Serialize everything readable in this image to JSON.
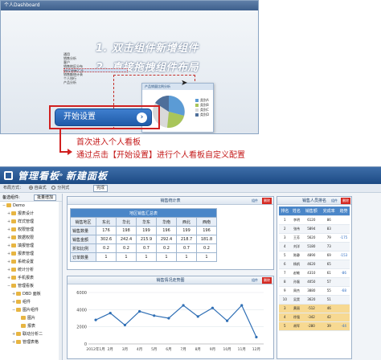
{
  "top_window": {
    "title": "个人Dashboard",
    "overlay_line1": "1. 双击组件新增组件",
    "overlay_line2": "2. 直接拖拽组件布局",
    "mini_tree": [
      "通用",
      "销售分析",
      "客户",
      "销售地区分布",
      "地区销售汇总",
      "销售额统计表",
      "个人排行",
      "产品分析"
    ],
    "mini_pie_title": "产品销量比例分析",
    "mini_pie_legend": [
      "类别A",
      "类别B",
      "类别C",
      "类别D"
    ],
    "mini_pie_colors": [
      "#5b9bd5",
      "#a8c55a",
      "#d9d9d9",
      "#4e6f9a"
    ],
    "start_button": "开始设置"
  },
  "callout": {
    "line1": "首次进入个人看板",
    "line2": "通过点击【开始设置】进行个人看板自定义配置"
  },
  "dashboard": {
    "title": "管理看板",
    "separator": "»",
    "subtitle": "新建面板",
    "toolbar": {
      "layout_label": "布局方式：",
      "option_auto": "自由式",
      "option_split": "分列式",
      "complete_button": "完成"
    },
    "sidebar": {
      "header": "备选组件:",
      "button": "批量增加",
      "items": [
        {
          "label": "Demo",
          "indent": 0,
          "toggle": "−"
        },
        {
          "label": "报表设计",
          "indent": 1,
          "toggle": "+"
        },
        {
          "label": "样式管理",
          "indent": 1,
          "toggle": "+"
        },
        {
          "label": "权限管理",
          "indent": 1,
          "toggle": "+"
        },
        {
          "label": "数据权限",
          "indent": 1,
          "toggle": "+"
        },
        {
          "label": "填报管理",
          "indent": 1,
          "toggle": "+"
        },
        {
          "label": "报表管理",
          "indent": 1,
          "toggle": "+"
        },
        {
          "label": "系统设置",
          "indent": 1,
          "toggle": "+"
        },
        {
          "label": "统计分析",
          "indent": 1,
          "toggle": "+"
        },
        {
          "label": "手机报表",
          "indent": 1,
          "toggle": "+"
        },
        {
          "label": "管理看板",
          "indent": 1,
          "toggle": "−"
        },
        {
          "label": "DBD 面板",
          "indent": 2,
          "toggle": "+"
        },
        {
          "label": "组件",
          "indent": 2,
          "toggle": "+"
        },
        {
          "label": "图片组件",
          "indent": 2,
          "toggle": "−"
        },
        {
          "label": "图片",
          "indent": 3,
          "toggle": ""
        },
        {
          "label": "报表",
          "indent": 3,
          "toggle": ""
        },
        {
          "label": "联动分析二",
          "indent": 2,
          "toggle": "+"
        },
        {
          "label": "管理表格",
          "indent": 2,
          "toggle": "+"
        }
      ]
    },
    "sales_panel": {
      "title": "销售统计表",
      "btn_settings": "组件",
      "btn_delete": "删除",
      "table_caption": "地区销售汇总表",
      "columns": [
        "销售地区",
        "东北",
        "华北",
        "华东",
        "华南",
        "西北",
        "西南"
      ],
      "rows": [
        [
          "销售数量",
          "176",
          "198",
          "199",
          "196",
          "199",
          "196"
        ],
        [
          "销售金额",
          "302.6",
          "242.4",
          "215.9",
          "292.4",
          "218.7",
          "181.8"
        ],
        [
          "折扣比例",
          "0.2",
          "0.2",
          "0.7",
          "0.2",
          "0.7",
          "0.2"
        ],
        [
          "订单数量",
          "1",
          "1",
          "1",
          "1",
          "1",
          "1"
        ]
      ]
    },
    "trend_panel": {
      "title": "销售情况走势图",
      "btn_settings": "组件",
      "btn_delete": "删除"
    },
    "rank_panel": {
      "title": "销售人员排名",
      "btn_settings": "组件",
      "btn_delete": "删除",
      "columns": [
        "排名",
        "姓名",
        "销售额",
        "完成率",
        "趋势"
      ],
      "rows": [
        [
          "1",
          "李明",
          "6120",
          "86",
          ""
        ],
        [
          "2",
          "张伟",
          "5894",
          "83",
          ""
        ],
        [
          "3",
          "王芳",
          "5620",
          "79",
          "-175"
        ],
        [
          "4",
          "刘洋",
          "5180",
          "73",
          ""
        ],
        [
          "5",
          "陈静",
          "4890",
          "69",
          "-153"
        ],
        [
          "6",
          "杨帆",
          "4620",
          "65",
          ""
        ],
        [
          "7",
          "赵敏",
          "4310",
          "61",
          "-86"
        ],
        [
          "8",
          "孙磊",
          "4050",
          "57",
          ""
        ],
        [
          "9",
          "周杰",
          "3880",
          "55",
          "-68"
        ],
        [
          "10",
          "吴昊",
          "3620",
          "51",
          ""
        ],
        [
          "3",
          "黄丽",
          "-512",
          "46",
          ""
        ],
        [
          "4",
          "徐强",
          "-342",
          "42",
          ""
        ],
        [
          "5",
          "胡军",
          "-280",
          "39",
          "-44"
        ]
      ]
    },
    "chart_data": {
      "type": "line",
      "x": [
        "2012年1月",
        "2月",
        "3月",
        "4月",
        "5月",
        "6月",
        "7月",
        "8月",
        "9月",
        "10月",
        "11月",
        "12月"
      ],
      "series": [
        {
          "values": [
            2800,
            3600,
            2200,
            3800,
            3300,
            3000,
            4500,
            3200,
            4200,
            2700,
            4500,
            800
          ]
        }
      ],
      "y_ticks": [
        "0",
        "2000",
        "4000",
        "6000"
      ],
      "ylim": [
        0,
        6000
      ],
      "color": "#2f6fb5"
    }
  }
}
